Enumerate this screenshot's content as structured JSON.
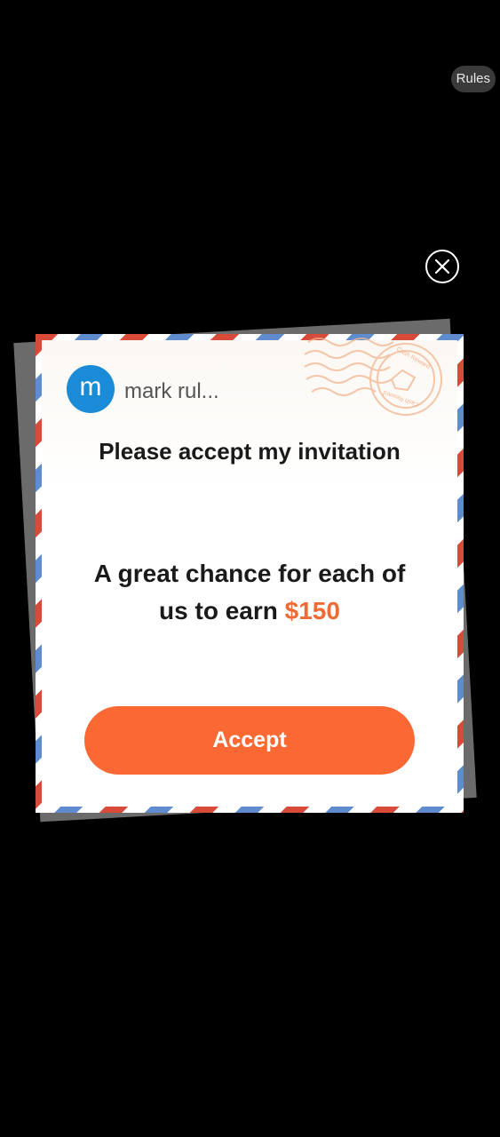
{
  "header": {
    "rules_label": "Rules"
  },
  "dialog": {
    "close_icon": "close-icon",
    "avatar_letter": "m",
    "sender_name": "mark rul...",
    "title": "Please accept my invitation",
    "message_line1": "A great chance for each of",
    "message_line2": "us to earn",
    "amount": "$150",
    "accept_label": "Accept",
    "stamp_text": "Cash Reward",
    "colors": {
      "accent": "#fa6934",
      "amount": "#f06a35",
      "avatar": "#1a8bd6",
      "stripe_red": "#d84b3b",
      "stripe_blue": "#5f8ccf"
    }
  }
}
